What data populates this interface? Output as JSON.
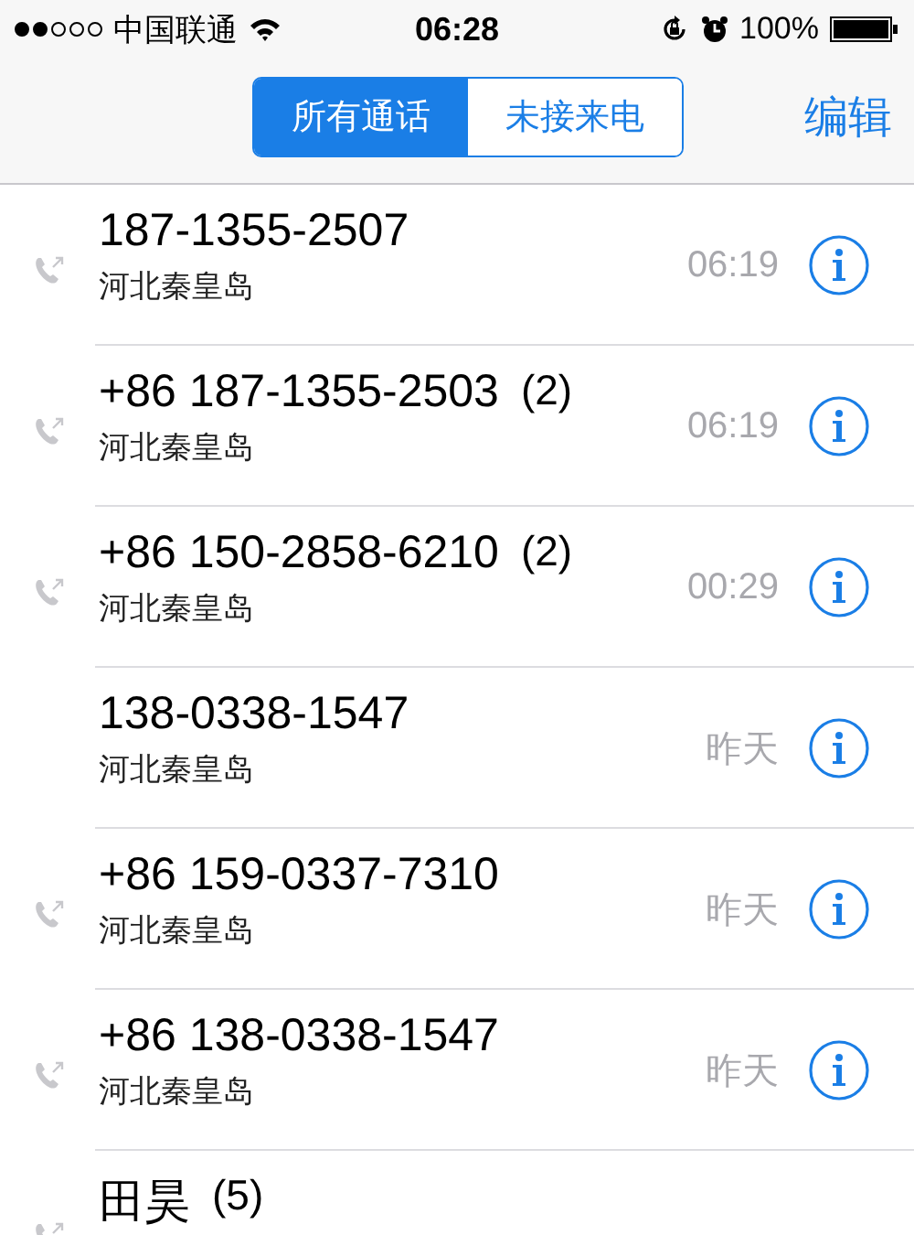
{
  "status_bar": {
    "carrier": "中国联通",
    "time": "06:28",
    "battery": "100%"
  },
  "nav": {
    "segments": [
      {
        "label": "所有通话",
        "selected": true
      },
      {
        "label": "未接来电",
        "selected": false
      }
    ],
    "edit": "编辑"
  },
  "calls": [
    {
      "name": "187-1355-2507",
      "location": "河北秦皇岛",
      "time": "06:19",
      "outgoing": true
    },
    {
      "name": "+86 187-1355-2503",
      "count": "(2)",
      "location": "河北秦皇岛",
      "time": "06:19",
      "outgoing": true
    },
    {
      "name": "+86 150-2858-6210",
      "count": "(2)",
      "location": "河北秦皇岛",
      "time": "00:29",
      "outgoing": true
    },
    {
      "name": "138-0338-1547",
      "location": "河北秦皇岛",
      "time": "昨天",
      "outgoing": false
    },
    {
      "name": "+86 159-0337-7310",
      "location": "河北秦皇岛",
      "time": "昨天",
      "outgoing": true
    },
    {
      "name": "+86 138-0338-1547",
      "location": "河北秦皇岛",
      "time": "昨天",
      "outgoing": true
    },
    {
      "name": "田昊",
      "count": "(5)",
      "outgoing": true
    }
  ]
}
